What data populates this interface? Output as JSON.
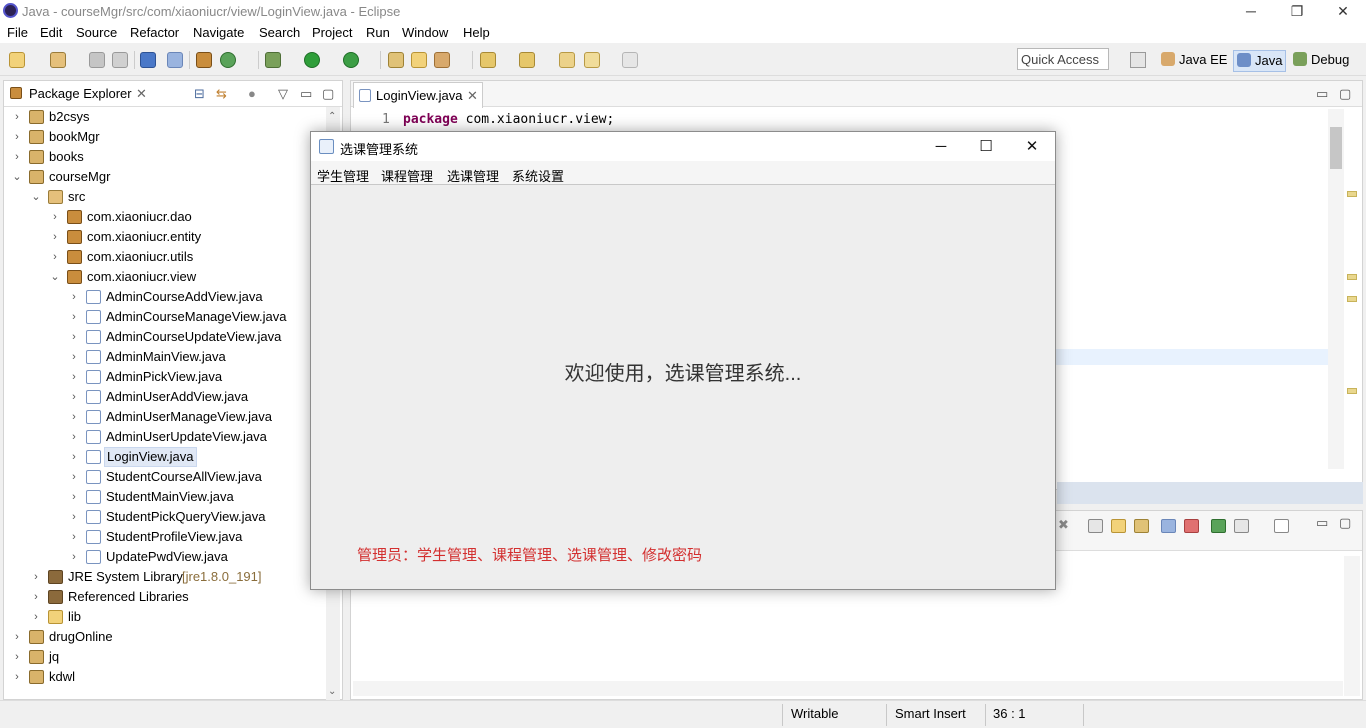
{
  "window": {
    "title": "Java - courseMgr/src/com/xiaoniucr/view/LoginView.java - Eclipse"
  },
  "window_controls": {
    "minimize": "─",
    "maximize": "❐",
    "close": "✕"
  },
  "menu": [
    "File",
    "Edit",
    "Source",
    "Refactor",
    "Navigate",
    "Search",
    "Project",
    "Run",
    "Window",
    "Help"
  ],
  "toolbar": {
    "quick_access_placeholder": "Quick Access"
  },
  "perspectives": [
    "Java EE",
    "Java",
    "Debug"
  ],
  "package_explorer": {
    "tab_label": "Package Explorer",
    "tree": [
      {
        "label": "b2csys",
        "icon": "project-icon"
      },
      {
        "label": "bookMgr",
        "icon": "project-icon"
      },
      {
        "label": "books",
        "icon": "project-icon"
      },
      {
        "label": "courseMgr",
        "icon": "project-icon"
      },
      {
        "label": "src",
        "icon": "source-folder-icon"
      },
      {
        "label": "com.xiaoniucr.dao",
        "icon": "package-icon"
      },
      {
        "label": "com.xiaoniucr.entity",
        "icon": "package-icon"
      },
      {
        "label": "com.xiaoniucr.utils",
        "icon": "package-icon"
      },
      {
        "label": "com.xiaoniucr.view",
        "icon": "package-icon"
      },
      {
        "label": "AdminCourseAddView.java",
        "icon": "java-file-icon"
      },
      {
        "label": "AdminCourseManageView.java",
        "icon": "java-file-icon"
      },
      {
        "label": "AdminCourseUpdateView.java",
        "icon": "java-file-icon"
      },
      {
        "label": "AdminMainView.java",
        "icon": "java-file-icon"
      },
      {
        "label": "AdminPickView.java",
        "icon": "java-file-icon"
      },
      {
        "label": "AdminUserAddView.java",
        "icon": "java-file-icon"
      },
      {
        "label": "AdminUserManageView.java",
        "icon": "java-file-icon"
      },
      {
        "label": "AdminUserUpdateView.java",
        "icon": "java-file-icon"
      },
      {
        "label": "LoginView.java",
        "icon": "java-file-icon"
      },
      {
        "label": "StudentCourseAllView.java",
        "icon": "java-file-icon"
      },
      {
        "label": "StudentMainView.java",
        "icon": "java-file-icon"
      },
      {
        "label": "StudentPickQueryView.java",
        "icon": "java-file-icon"
      },
      {
        "label": "StudentProfileView.java",
        "icon": "java-file-icon"
      },
      {
        "label": "UpdatePwdView.java",
        "icon": "java-file-icon"
      },
      {
        "label": "JRE System Library",
        "suffix": "[jre1.8.0_191]",
        "icon": "library-icon"
      },
      {
        "label": "Referenced Libraries",
        "icon": "library-icon"
      },
      {
        "label": "lib",
        "icon": "folder-icon"
      },
      {
        "label": "drugOnline",
        "icon": "project-icon"
      },
      {
        "label": "jq",
        "icon": "project-icon"
      },
      {
        "label": "kdwl",
        "icon": "project-icon"
      }
    ],
    "selected": "LoginView.java"
  },
  "editor": {
    "tab_label": "LoginView.java",
    "line_number": "1",
    "keyword": "package",
    "code_rest": " com.xiaoniucr.view;"
  },
  "status": {
    "writable": "Writable",
    "insert_mode": "Smart Insert",
    "position": "36 : 1"
  },
  "dialog": {
    "title": "选课管理系统",
    "menu": [
      "学生管理",
      "课程管理",
      "选课管理",
      "系统设置"
    ],
    "welcome": "欢迎使用，选课管理系统...",
    "admin_text": "管理员：学生管理、课程管理、选课管理、修改密码"
  },
  "colors": {
    "keyword": "#7f0055",
    "admin_text": "#d32f2f",
    "selection": "#e0e8f5"
  }
}
